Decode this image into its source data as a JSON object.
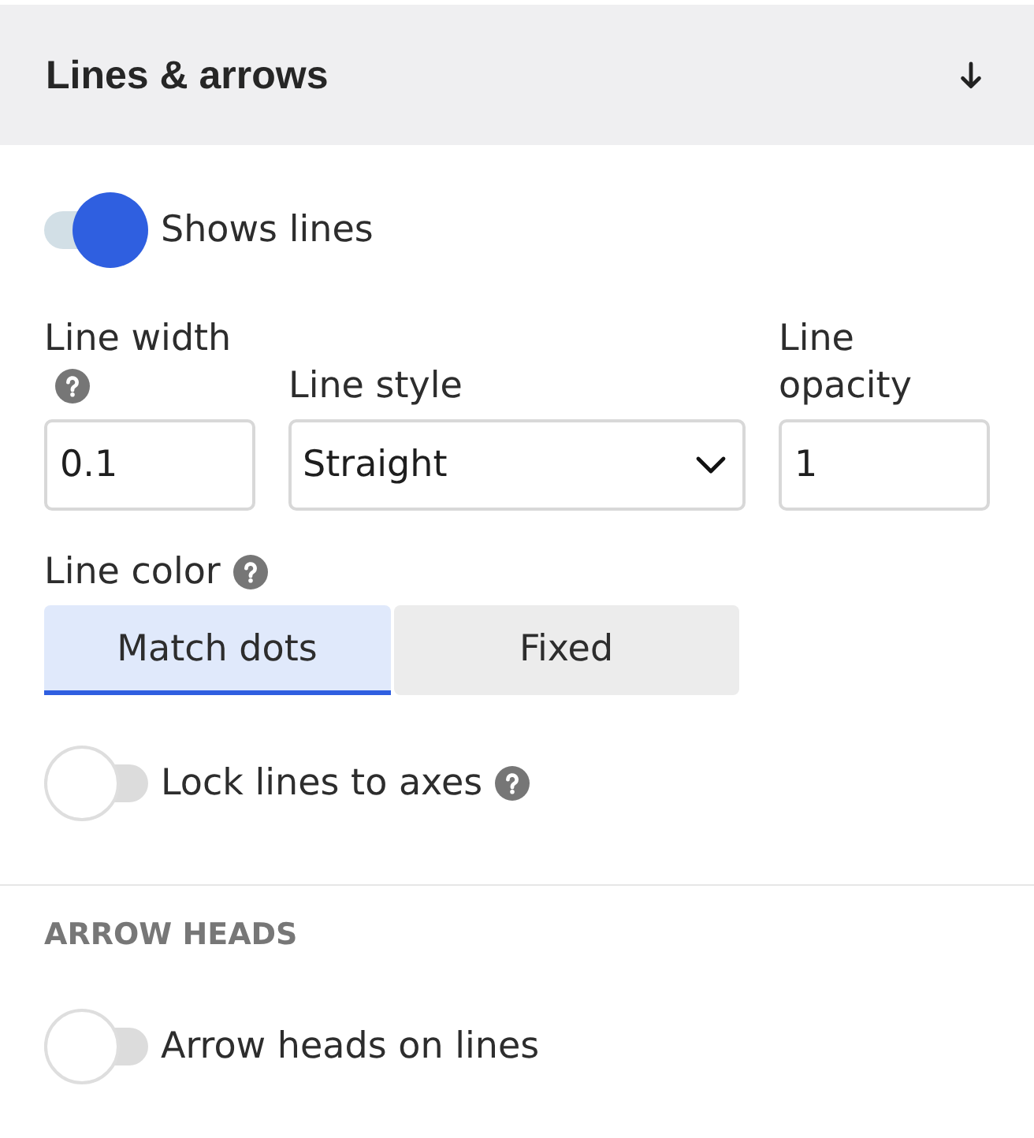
{
  "panel": {
    "title": "Lines & arrows"
  },
  "show_lines": {
    "label": "Shows lines",
    "on": true
  },
  "fields": [
    {
      "kind": "number",
      "label": "Line width",
      "help": true,
      "value": "0.1"
    },
    {
      "kind": "select",
      "label": "Line style",
      "value": "Straight"
    },
    {
      "kind": "number",
      "label": "Line opacity",
      "value": "1"
    }
  ],
  "line_color": {
    "label": "Line color",
    "help": true,
    "options": [
      {
        "label": "Match dots",
        "selected": true
      },
      {
        "label": "Fixed",
        "selected": false
      }
    ]
  },
  "lock_lines": {
    "label": "Lock lines to axes",
    "help": true,
    "on": false
  },
  "arrow_heads": {
    "heading": "ARROW HEADS",
    "toggle": {
      "label": "Arrow heads on lines",
      "on": false
    }
  }
}
